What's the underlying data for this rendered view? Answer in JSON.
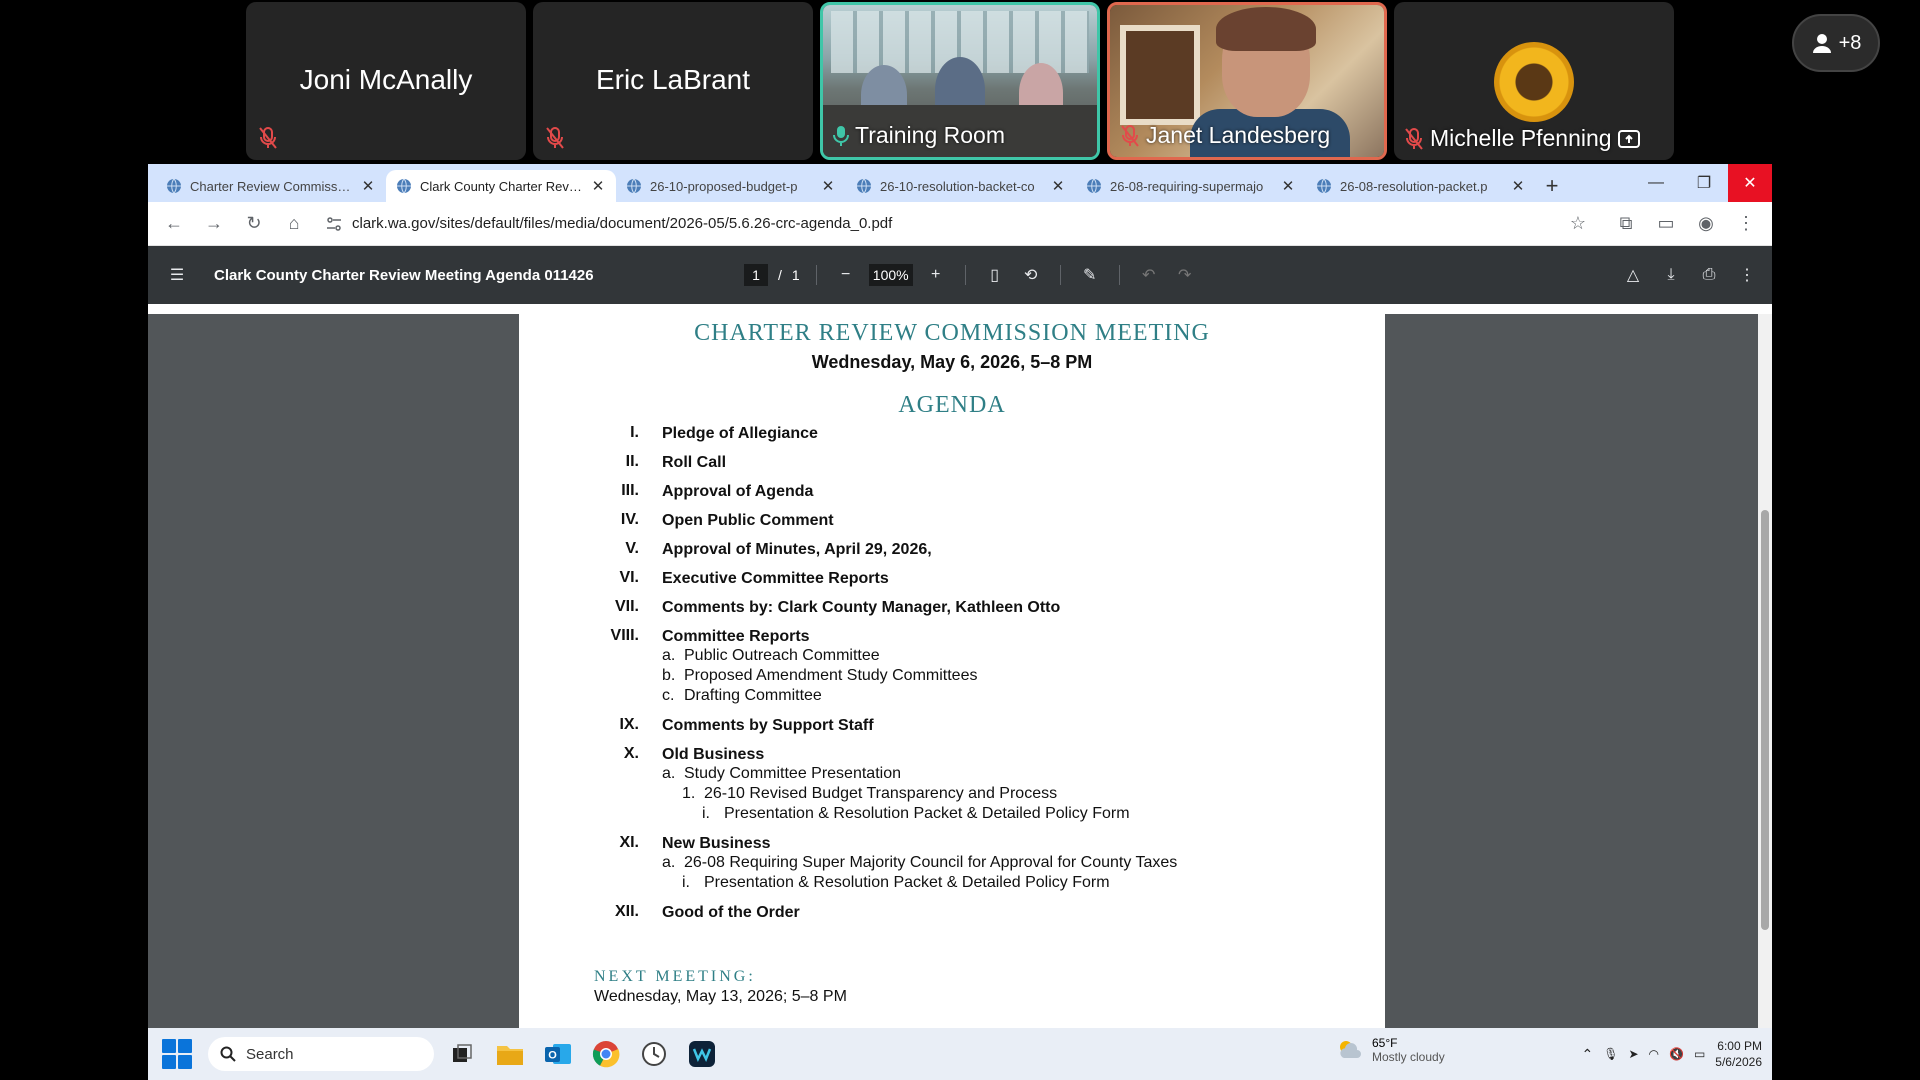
{
  "call": {
    "participants": [
      {
        "name": "Joni McAnally",
        "muted": true
      },
      {
        "name": "Eric LaBrant",
        "muted": true
      },
      {
        "name": "Training Room",
        "muted": false
      },
      {
        "name": "Janet Landesberg",
        "muted": true
      },
      {
        "name": "Michelle Pfenning",
        "muted": true
      }
    ],
    "more_count": "+8"
  },
  "browser": {
    "tabs": [
      {
        "title": "Charter Review Commission"
      },
      {
        "title": "Clark County Charter Review"
      },
      {
        "title": "26-10-proposed-budget-p"
      },
      {
        "title": "26-10-resolution-backet-co"
      },
      {
        "title": "26-08-requiring-supermajo"
      },
      {
        "title": "26-08-resolution-packet.p"
      }
    ],
    "url": "clark.wa.gov/sites/default/files/media/document/2026-05/5.6.26-crc-agenda_0.pdf"
  },
  "pdf": {
    "title": "Clark County Charter Review Meeting Agenda 011426",
    "page_current": "1",
    "page_sep": "/",
    "page_total": "1",
    "zoom": "100%"
  },
  "doc": {
    "title": "CHARTER REVIEW COMMISSION MEETING",
    "date": "Wednesday, May 6, 2026, 5–8 PM",
    "agenda_heading": "AGENDA",
    "items": [
      {
        "num": "I.",
        "label": "Pledge of Allegiance"
      },
      {
        "num": "II.",
        "label": "Roll Call"
      },
      {
        "num": "III.",
        "label": "Approval of Agenda"
      },
      {
        "num": "IV.",
        "label": "Open Public Comment"
      },
      {
        "num": "V.",
        "label": "Approval of Minutes, April 29, 2026,"
      },
      {
        "num": "VI.",
        "label": "Executive Committee Reports"
      },
      {
        "num": "VII.",
        "label": "Comments by: Clark County Manager, Kathleen Otto"
      },
      {
        "num": "VIII.",
        "label": "Committee Reports",
        "subs": [
          {
            "marker": "a.",
            "text": "Public Outreach Committee"
          },
          {
            "marker": "b.",
            "text": "Proposed Amendment Study Committees"
          },
          {
            "marker": "c.",
            "text": "Drafting Committee"
          }
        ]
      },
      {
        "num": "IX.",
        "label": "Comments by Support Staff"
      },
      {
        "num": "X.",
        "label": "Old Business",
        "subs": [
          {
            "marker": "a.",
            "text": "Study Committee Presentation"
          },
          {
            "marker": "1.",
            "text": "26-10 Revised Budget Transparency and Process"
          },
          {
            "marker": "i.",
            "text": "Presentation & Resolution Packet & Detailed Policy Form"
          }
        ]
      },
      {
        "num": "XI.",
        "label": "New Business",
        "subs": [
          {
            "marker": "a.",
            "text": "26-08 Requiring Super Majority Council for Approval for County Taxes"
          },
          {
            "marker": "i.",
            "text": "Presentation & Resolution Packet & Detailed Policy Form"
          }
        ]
      },
      {
        "num": "XII.",
        "label": "Good of the Order"
      }
    ],
    "next_meeting_label": "NEXT MEETING:",
    "next_meeting_date": "Wednesday, May 13, 2026; 5–8 PM"
  },
  "taskbar": {
    "search_placeholder": "Search",
    "weather_temp": "65°F",
    "weather_desc": "Mostly cloudy",
    "time": "6:00 PM",
    "date": "5/6/2026"
  },
  "colors": {
    "accent_teal": "#2f7f86",
    "active_tile_border": "#3fc6a8",
    "close_red": "#e81123"
  }
}
